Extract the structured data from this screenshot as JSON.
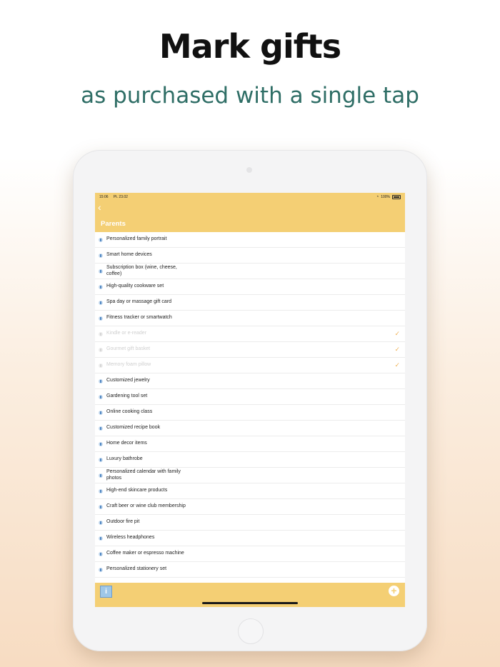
{
  "headline": "Mark gifts",
  "subline": "as purchased with a single tap",
  "status_bar": {
    "time": "15:06",
    "date": "Pt. 23.02",
    "battery": "100%"
  },
  "nav": {
    "title": "Parents"
  },
  "items": [
    {
      "label": "Personalized family portrait",
      "purchased": false
    },
    {
      "label": "Smart home devices",
      "purchased": false
    },
    {
      "label": "Subscription box (wine, cheese, coffee)",
      "purchased": false
    },
    {
      "label": "High-quality cookware set",
      "purchased": false
    },
    {
      "label": "Spa day or massage gift card",
      "purchased": false
    },
    {
      "label": "Fitness tracker or smartwatch",
      "purchased": false
    },
    {
      "label": "Kindle or e-reader",
      "purchased": true
    },
    {
      "label": "Gourmet gift basket",
      "purchased": true
    },
    {
      "label": "Memory foam pillow",
      "purchased": true
    },
    {
      "label": "Customized jewelry",
      "purchased": false
    },
    {
      "label": "Gardening tool set",
      "purchased": false
    },
    {
      "label": "Online cooking class",
      "purchased": false
    },
    {
      "label": "Customized recipe book",
      "purchased": false
    },
    {
      "label": "Home decor items",
      "purchased": false
    },
    {
      "label": "Luxury bathrobe",
      "purchased": false
    },
    {
      "label": "Personalized calendar with family photos",
      "purchased": false
    },
    {
      "label": "High-end skincare products",
      "purchased": false
    },
    {
      "label": "Craft beer or wine club membership",
      "purchased": false
    },
    {
      "label": "Outdoor fire pit",
      "purchased": false
    },
    {
      "label": "Wireless headphones",
      "purchased": false
    },
    {
      "label": "Coffee maker or espresso machine",
      "purchased": false
    },
    {
      "label": "Personalized stationery set",
      "purchased": false
    }
  ],
  "check_symbol": "✓",
  "toolbar": {
    "info_symbol": "i",
    "add_symbol": "+"
  },
  "colors": {
    "header": "#f4cf74",
    "accent_check": "#f0b35a",
    "subline": "#2f6e66"
  }
}
